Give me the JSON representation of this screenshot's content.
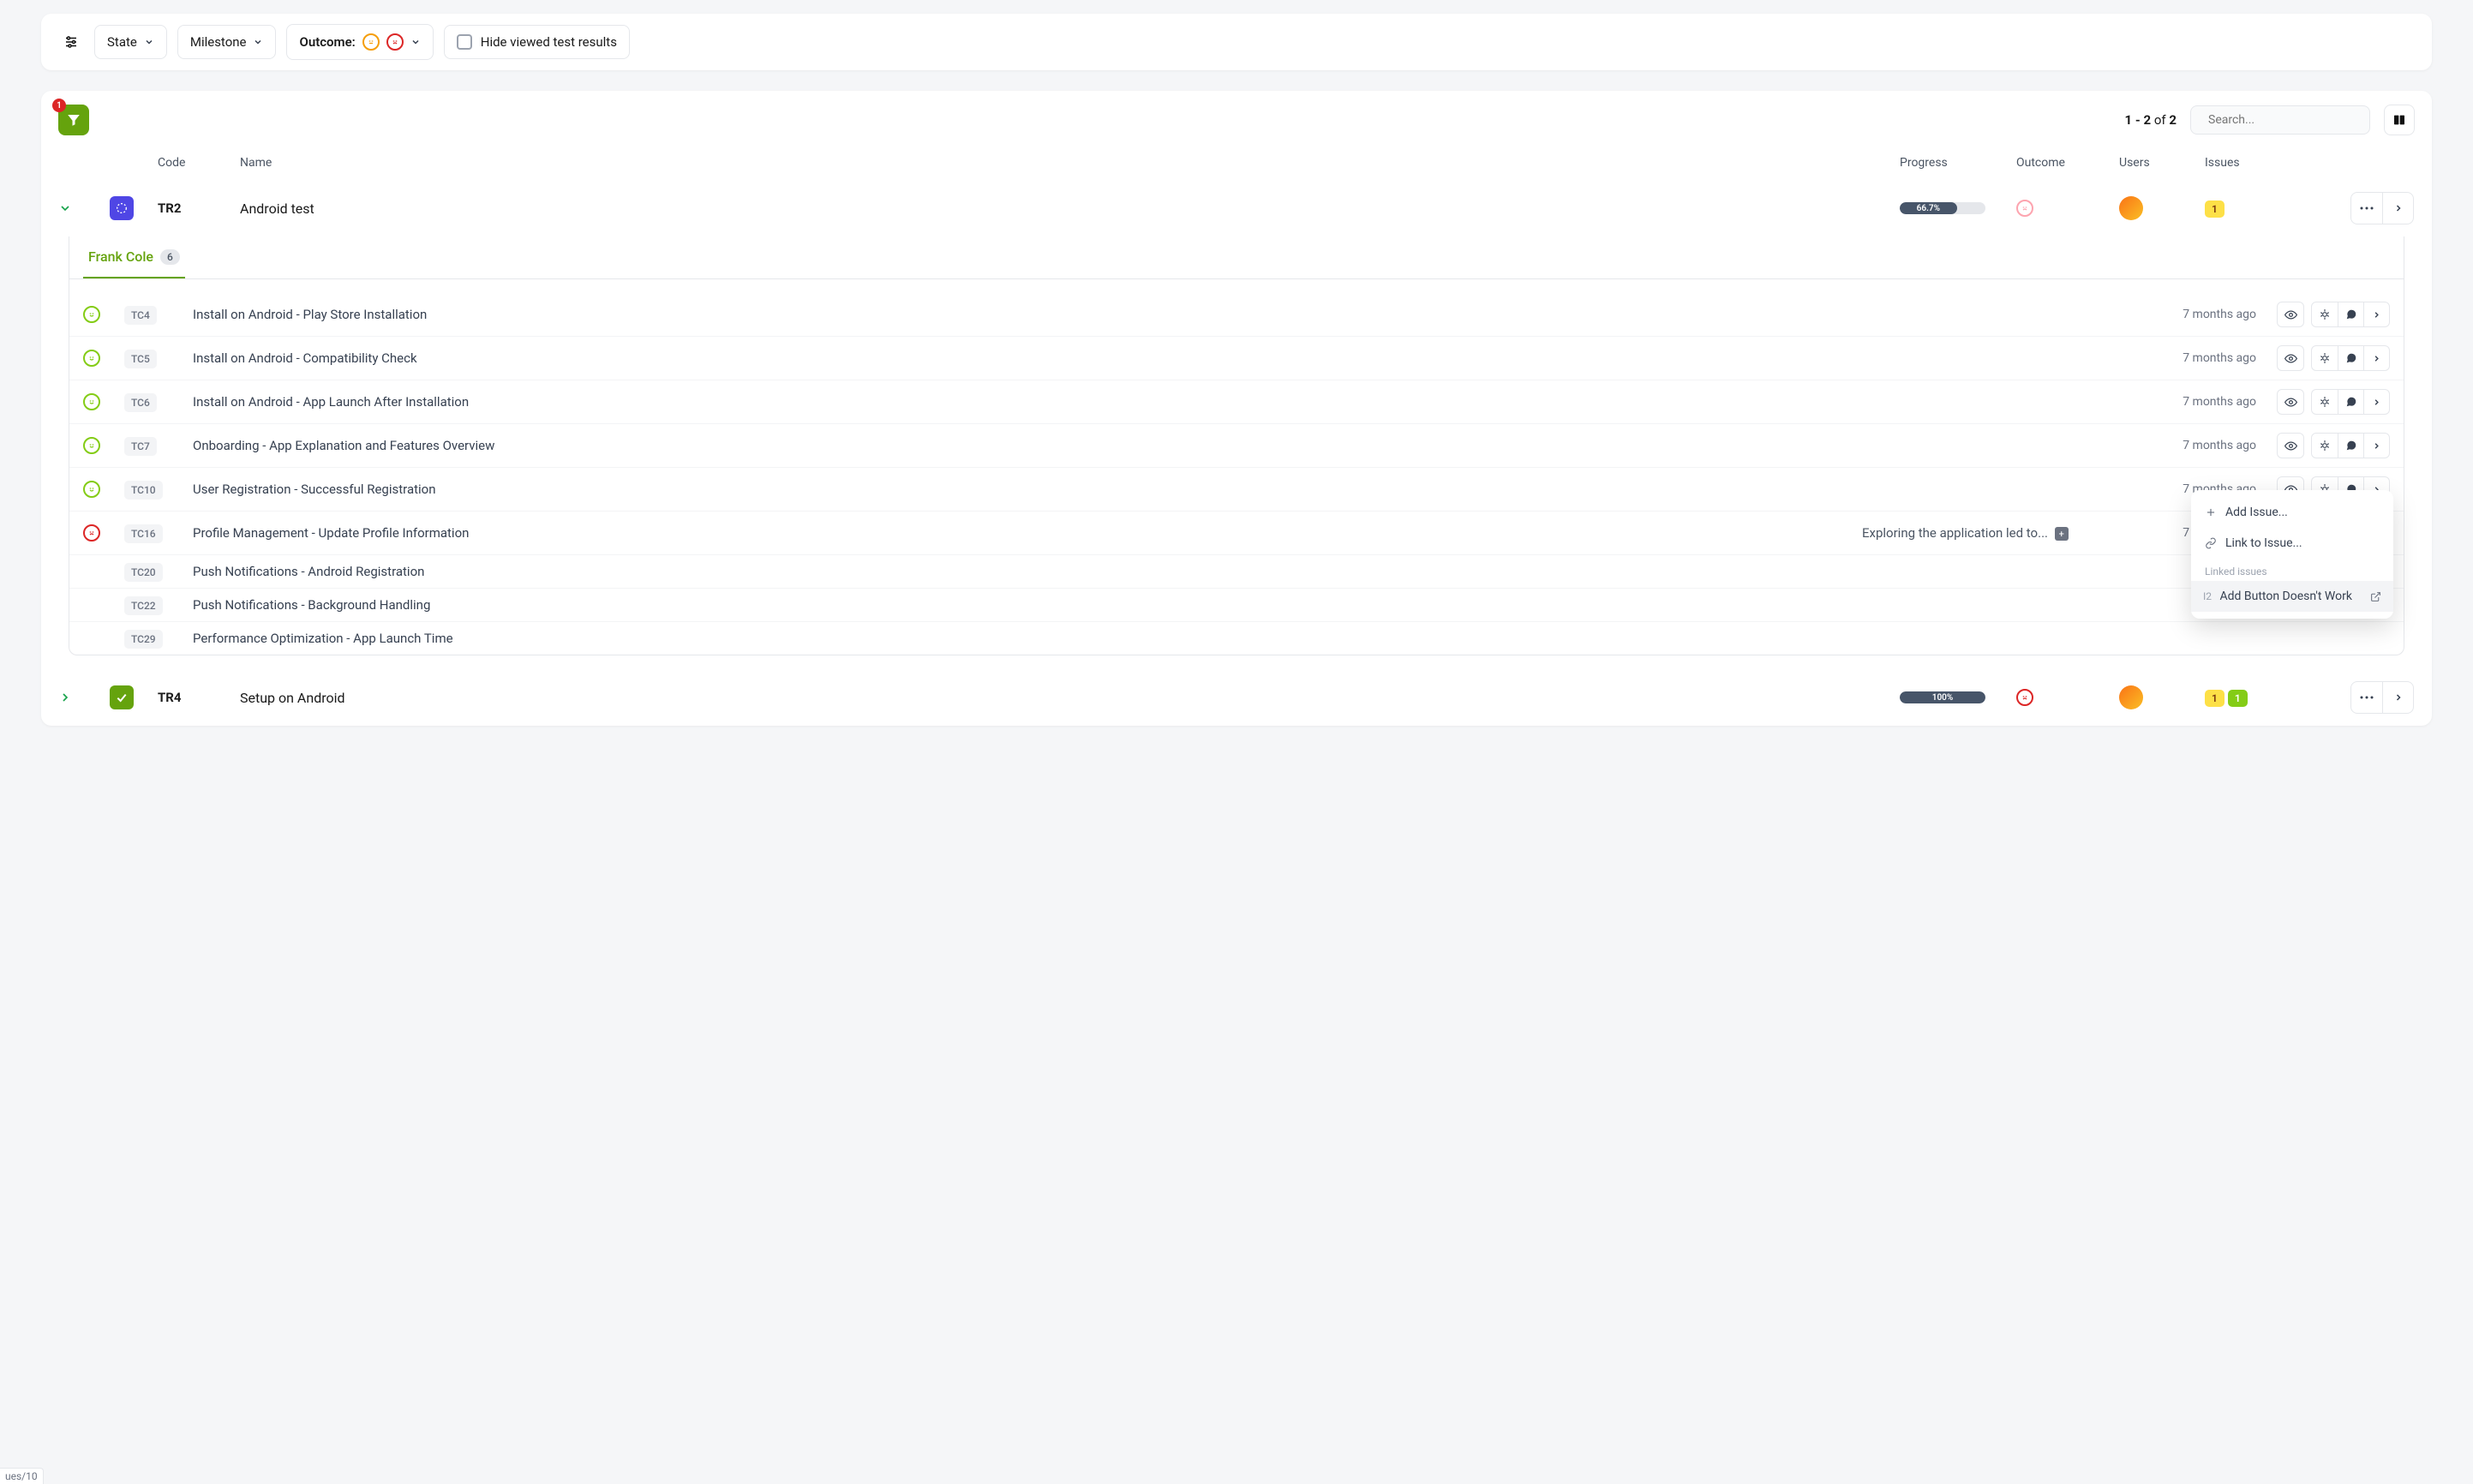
{
  "filters": {
    "state_label": "State",
    "milestone_label": "Milestone",
    "outcome_label": "Outcome:",
    "hide_viewed_label": "Hide viewed test results"
  },
  "toolbar": {
    "filter_badge": "1",
    "pagination_range": "1 - 2",
    "pagination_of": "of",
    "pagination_total": "2",
    "search_placeholder": "Search..."
  },
  "columns": {
    "code": "Code",
    "name": "Name",
    "progress": "Progress",
    "outcome": "Outcome",
    "users": "Users",
    "issues": "Issues"
  },
  "runs": [
    {
      "code": "TR2",
      "name": "Android test",
      "progress_pct": "66.7%",
      "progress_width": 66.7,
      "outcome": "sad-pink",
      "issues_yellow": "1",
      "icon": "blue",
      "expanded": true,
      "tab_name": "Frank Cole",
      "tab_count": "6",
      "testcases": [
        {
          "face": "happy",
          "code": "TC4",
          "name": "Install on Android - Play Store Installation",
          "time": "7 months ago",
          "bug_active": false
        },
        {
          "face": "happy",
          "code": "TC5",
          "name": "Install on Android - Compatibility Check",
          "time": "7 months ago",
          "bug_active": false
        },
        {
          "face": "happy",
          "code": "TC6",
          "name": "Install on Android - App Launch After Installation",
          "time": "7 months ago",
          "bug_active": false
        },
        {
          "face": "happy",
          "code": "TC7",
          "name": "Onboarding - App Explanation and Features Overview",
          "time": "7 months ago",
          "bug_active": false
        },
        {
          "face": "happy",
          "code": "TC10",
          "name": "User Registration - Successful Registration",
          "time": "7 months ago",
          "bug_active": false
        },
        {
          "face": "sad",
          "code": "TC16",
          "name": "Profile Management - Update Profile Information",
          "preview": "Exploring the application led to...",
          "time": "7 months ago",
          "bug_active": true
        },
        {
          "face": "none",
          "code": "TC20",
          "name": "Push Notifications - Android Registration"
        },
        {
          "face": "none",
          "code": "TC22",
          "name": "Push Notifications - Background Handling"
        },
        {
          "face": "none",
          "code": "TC29",
          "name": "Performance Optimization - App Launch Time"
        }
      ]
    },
    {
      "code": "TR4",
      "name": "Setup on Android",
      "progress_pct": "100%",
      "progress_width": 100,
      "outcome": "sad",
      "issues_yellow": "1",
      "issues_green": "1",
      "icon": "green",
      "expanded": false
    }
  ],
  "menu": {
    "add_issue": "Add Issue...",
    "link_issue": "Link to Issue...",
    "section_label": "Linked issues",
    "linked_code": "I2",
    "linked_name": "Add Button Doesn't Work"
  },
  "footer_url": "ues/10"
}
